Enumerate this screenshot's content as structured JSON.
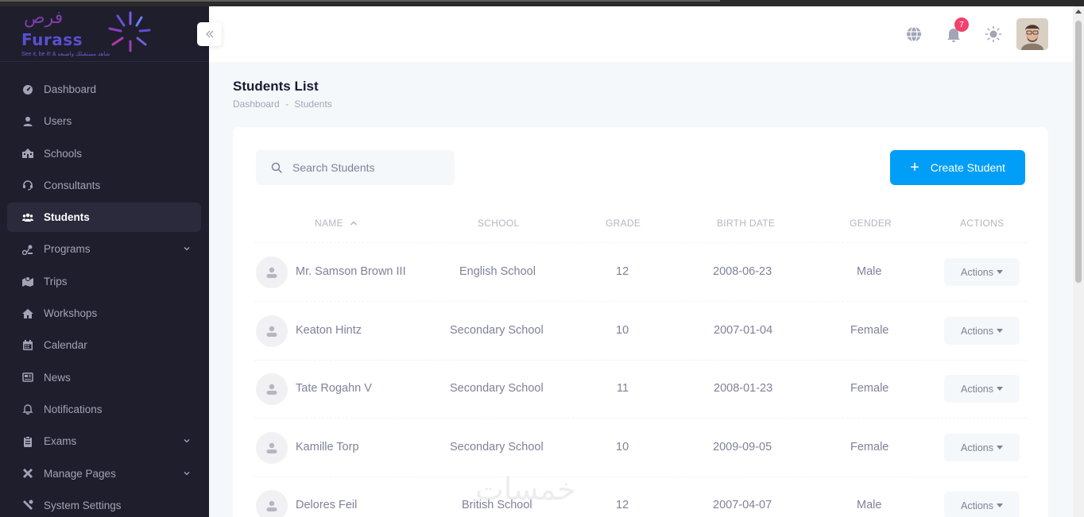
{
  "brand": {
    "arabic_name": "فرص",
    "name": "Furass",
    "tagline": "See it, be it! & شاهد مستقبلك واصنعه"
  },
  "sidebar": {
    "items": [
      {
        "label": "Dashboard",
        "icon": "dashboard-icon",
        "active": false,
        "has_children": false
      },
      {
        "label": "Users",
        "icon": "user-icon",
        "active": false,
        "has_children": false
      },
      {
        "label": "Schools",
        "icon": "school-icon",
        "active": false,
        "has_children": false
      },
      {
        "label": "Consultants",
        "icon": "headset-icon",
        "active": false,
        "has_children": false
      },
      {
        "label": "Students",
        "icon": "users-group-icon",
        "active": true,
        "has_children": false
      },
      {
        "label": "Programs",
        "icon": "programs-icon",
        "active": false,
        "has_children": true
      },
      {
        "label": "Trips",
        "icon": "map-icon",
        "active": false,
        "has_children": false
      },
      {
        "label": "Workshops",
        "icon": "workshop-icon",
        "active": false,
        "has_children": false
      },
      {
        "label": "Calendar",
        "icon": "calendar-icon",
        "active": false,
        "has_children": false
      },
      {
        "label": "News",
        "icon": "newspaper-icon",
        "active": false,
        "has_children": false
      },
      {
        "label": "Notifications",
        "icon": "bell-icon",
        "active": false,
        "has_children": false
      },
      {
        "label": "Exams",
        "icon": "clipboard-icon",
        "active": false,
        "has_children": true
      },
      {
        "label": "Manage Pages",
        "icon": "tools-icon",
        "active": false,
        "has_children": true
      },
      {
        "label": "System Settings",
        "icon": "settings-icon",
        "active": false,
        "has_children": false
      }
    ]
  },
  "header": {
    "notification_count": "7",
    "icons": [
      "globe-icon",
      "bell-icon",
      "sun-icon"
    ]
  },
  "page": {
    "title": "Students List",
    "breadcrumb": [
      "Dashboard",
      "-",
      "Students"
    ]
  },
  "toolbar": {
    "search_placeholder": "Search Students",
    "create_label": "Create Student"
  },
  "table": {
    "columns": [
      "NAME",
      "SCHOOL",
      "GRADE",
      "BIRTH DATE",
      "GENDER",
      "ACTIONS"
    ],
    "sort_column": "NAME",
    "sort_direction": "asc",
    "action_label": "Actions",
    "rows": [
      {
        "name": "Mr. Samson Brown III",
        "school": "English School",
        "grade": "12",
        "birth_date": "2008-06-23",
        "gender": "Male"
      },
      {
        "name": "Keaton Hintz",
        "school": "Secondary School",
        "grade": "10",
        "birth_date": "2007-01-04",
        "gender": "Female"
      },
      {
        "name": "Tate Rogahn V",
        "school": "Secondary School",
        "grade": "11",
        "birth_date": "2008-01-23",
        "gender": "Female"
      },
      {
        "name": "Kamille Torp",
        "school": "Secondary School",
        "grade": "10",
        "birth_date": "2009-09-05",
        "gender": "Female"
      },
      {
        "name": "Delores Feil",
        "school": "British School",
        "grade": "12",
        "birth_date": "2007-04-07",
        "gender": "Male"
      }
    ]
  },
  "watermark": "خمسات",
  "colors": {
    "sidebar_bg": "#1e1e2d",
    "primary": "#009ef7",
    "badge": "#f1416c"
  }
}
